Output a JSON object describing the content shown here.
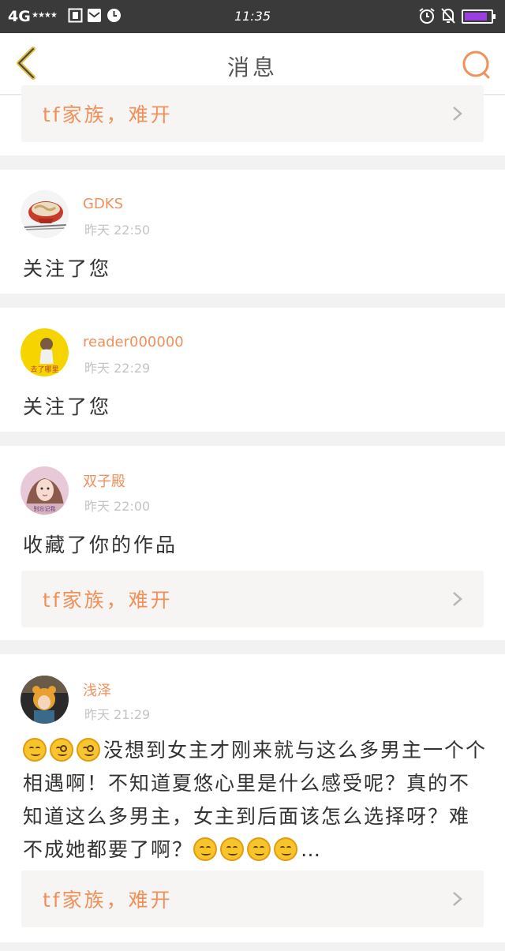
{
  "status_bar": {
    "signal": "4G",
    "stars": "★★★★",
    "time": "11:35",
    "battery_level": 0.88,
    "battery_color": "#9b3fe0"
  },
  "header": {
    "title": "消息",
    "accent_color": "#f0905a",
    "back_icon": "chevron-left-icon",
    "search_icon": "search-icon"
  },
  "top_card": {
    "work_title": "tf家族，难开"
  },
  "notifications": [
    {
      "username": "GDKS",
      "time": "昨天 22:50",
      "message": "关注了您"
    },
    {
      "username": "reader000000",
      "time": "昨天 22:29",
      "message": "关注了您",
      "avatar_caption": "去了哪里"
    },
    {
      "username": "双子殿",
      "time": "昨天 22:00",
      "message": "收藏了你的作品",
      "work_title": "tf家族，难开",
      "avatar_caption": "别忘记我"
    },
    {
      "username": "浅泽",
      "time": "昨天 21:29",
      "message_part1": "没想到女主才刚来就与这么多男主一个个相遇啊！不知道夏悠心里是什么感受呢？真的不知道这么多男主，女主到后面该怎么选择呀？难不成她都要了啊？",
      "message_ellipsis": "…",
      "work_title": "tf家族，难开"
    }
  ]
}
